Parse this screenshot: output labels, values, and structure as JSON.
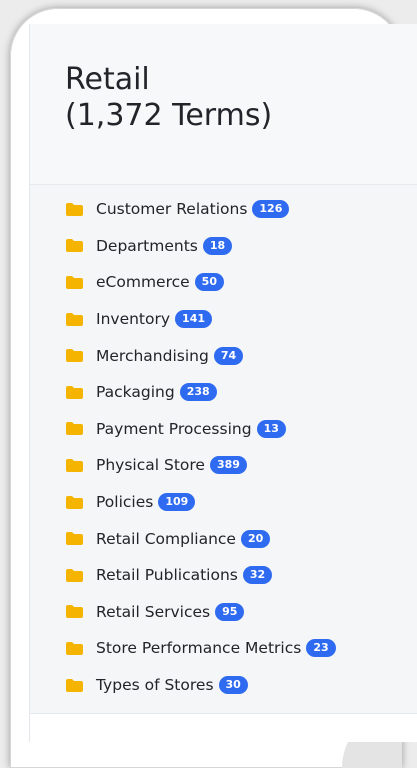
{
  "colors": {
    "folder": "#f4b400",
    "badge": "#2f6bf0",
    "text": "#212529"
  },
  "category": {
    "name": "Retail",
    "term_count_label": "(1,372 Terms)"
  },
  "items": [
    {
      "label": "Customer Relations",
      "count": "126",
      "icon": "folder-icon"
    },
    {
      "label": "Departments",
      "count": "18",
      "icon": "folder-icon"
    },
    {
      "label": "eCommerce",
      "count": "50",
      "icon": "folder-icon"
    },
    {
      "label": "Inventory",
      "count": "141",
      "icon": "folder-icon"
    },
    {
      "label": "Merchandising",
      "count": "74",
      "icon": "folder-icon"
    },
    {
      "label": "Packaging",
      "count": "238",
      "icon": "folder-icon"
    },
    {
      "label": "Payment Processing",
      "count": "13",
      "icon": "folder-icon"
    },
    {
      "label": "Physical Store",
      "count": "389",
      "icon": "folder-icon"
    },
    {
      "label": "Policies",
      "count": "109",
      "icon": "folder-icon"
    },
    {
      "label": "Retail Compliance",
      "count": "20",
      "icon": "folder-icon"
    },
    {
      "label": "Retail Publications",
      "count": "32",
      "icon": "folder-icon"
    },
    {
      "label": "Retail Services",
      "count": "95",
      "icon": "folder-icon"
    },
    {
      "label": "Store Performance Metrics",
      "count": "23",
      "icon": "folder-icon"
    },
    {
      "label": "Types of Stores",
      "count": "30",
      "icon": "folder-icon"
    }
  ]
}
